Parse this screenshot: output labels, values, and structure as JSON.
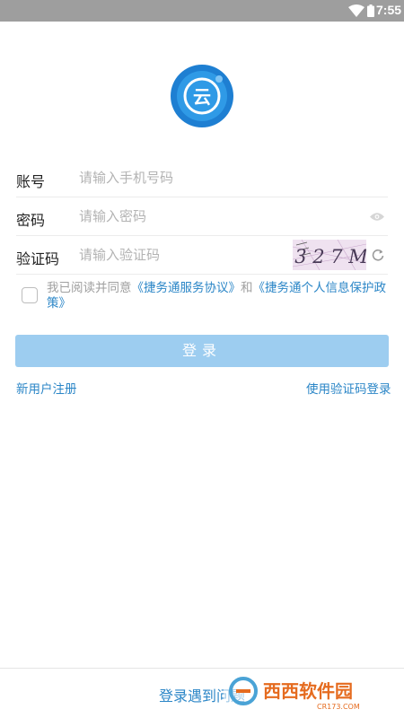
{
  "status_bar": {
    "time": "7:55",
    "wifi_icon": "wifi-icon",
    "battery_icon": "battery-icon"
  },
  "logo": {
    "glyph": "云",
    "icon": "cloud-logo-icon",
    "color": "#1e7fd2"
  },
  "form": {
    "account_label": "账号",
    "account_placeholder": "请输入手机号码",
    "password_label": "密码",
    "password_placeholder": "请输入密码",
    "captcha_label": "验证码",
    "captcha_placeholder": "请输入验证码",
    "captcha_text": "3 2 7 M"
  },
  "agreement": {
    "prefix": "我已阅读并同意",
    "service_link": "《捷务通服务协议》",
    "and": "和",
    "privacy_link": "《捷务通个人信息保护政策》"
  },
  "login_button": "登录",
  "links": {
    "register": "新用户注册",
    "sms_login": "使用验证码登录"
  },
  "footer": {
    "help": "登录遇到问题",
    "watermark": "西西软件园",
    "watermark_sub": "CR173.COM"
  },
  "colors": {
    "accent": "#2b86c7",
    "button": "#9dcdf0",
    "status_bar": "#9e9e9e"
  }
}
